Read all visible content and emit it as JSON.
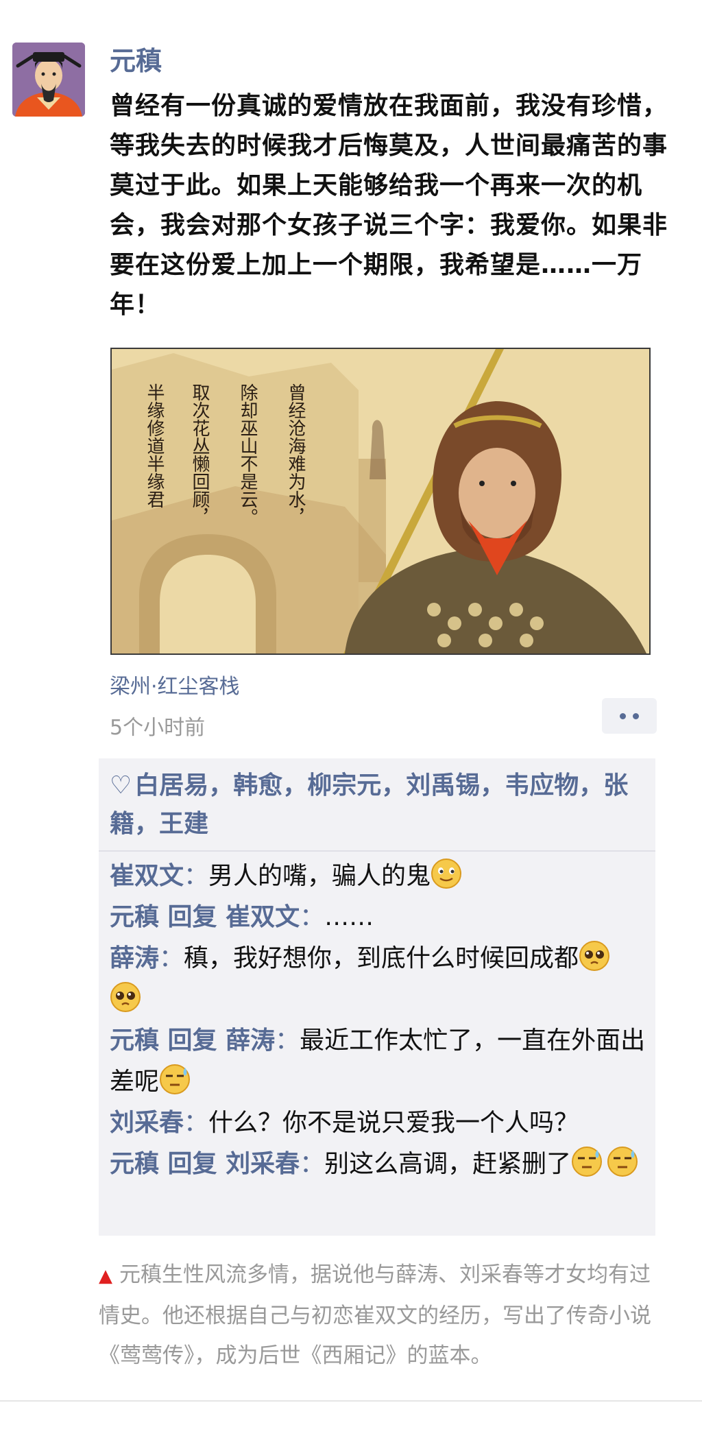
{
  "post": {
    "author": "元稹",
    "text": "曾经有一份真诚的爱情放在我面前，我没有珍惜，等我失去的时候我才后悔莫及，人世间最痛苦的事莫过于此。如果上天能够给我一个再来一次的机会，我会对那个女孩子说三个字：我爱你。如果非要在这份爱上加上一个期限，我希望是……一万年！",
    "location": "梁州·红尘客栈",
    "time": "5个小时前"
  },
  "image": {
    "poem_columns": [
      "曾经沧海难为水，",
      "除却巫山不是云。",
      "取次花丛懒回顾，",
      "半缘修道半缘君"
    ]
  },
  "likes": {
    "names_text": "白居易，韩愈，柳宗元，刘禹锡，韦应物，张籍，王建"
  },
  "comments": [
    {
      "name": "崔双文",
      "sep": "：",
      "text": "男人的嘴，骗人的鬼",
      "emojis": [
        "smile-emoji"
      ]
    },
    {
      "name": "元稹",
      "reply_word": "回复",
      "reply_to": "崔双文",
      "sep": "：",
      "text": "……",
      "emojis": []
    },
    {
      "name": "薛涛",
      "sep": "：",
      "text": "稹，我好想你，到底什么时候回成都",
      "emojis": [
        "pleading-emoji",
        "pleading-emoji"
      ]
    },
    {
      "name": "元稹",
      "reply_word": "回复",
      "reply_to": "薛涛",
      "sep": "：",
      "text": "最近工作太忙了，一直在外面出差呢",
      "emojis": [
        "sweat-emoji"
      ]
    },
    {
      "name": "刘采春",
      "sep": "：",
      "text": "什么？你不是说只爱我一个人吗？",
      "emojis": []
    },
    {
      "name": "元稹",
      "reply_word": "回复",
      "reply_to": "刘采春",
      "sep": "：",
      "text": "别这么高调，赶紧删了",
      "emojis": [
        "sweat-emoji",
        "sweat-emoji"
      ]
    }
  ],
  "footnote": {
    "text": "元稹生性风流多情，据说他与薛涛、刘采春等才女均有过情史。他还根据自己与初恋崔双文的经历，写出了传奇小说《莺莺传》，成为后世《西厢记》的蓝本。"
  },
  "colors": {
    "link": "#576b95",
    "muted": "#999999",
    "comment_bg": "#f2f2f5",
    "marker": "#e02020"
  }
}
